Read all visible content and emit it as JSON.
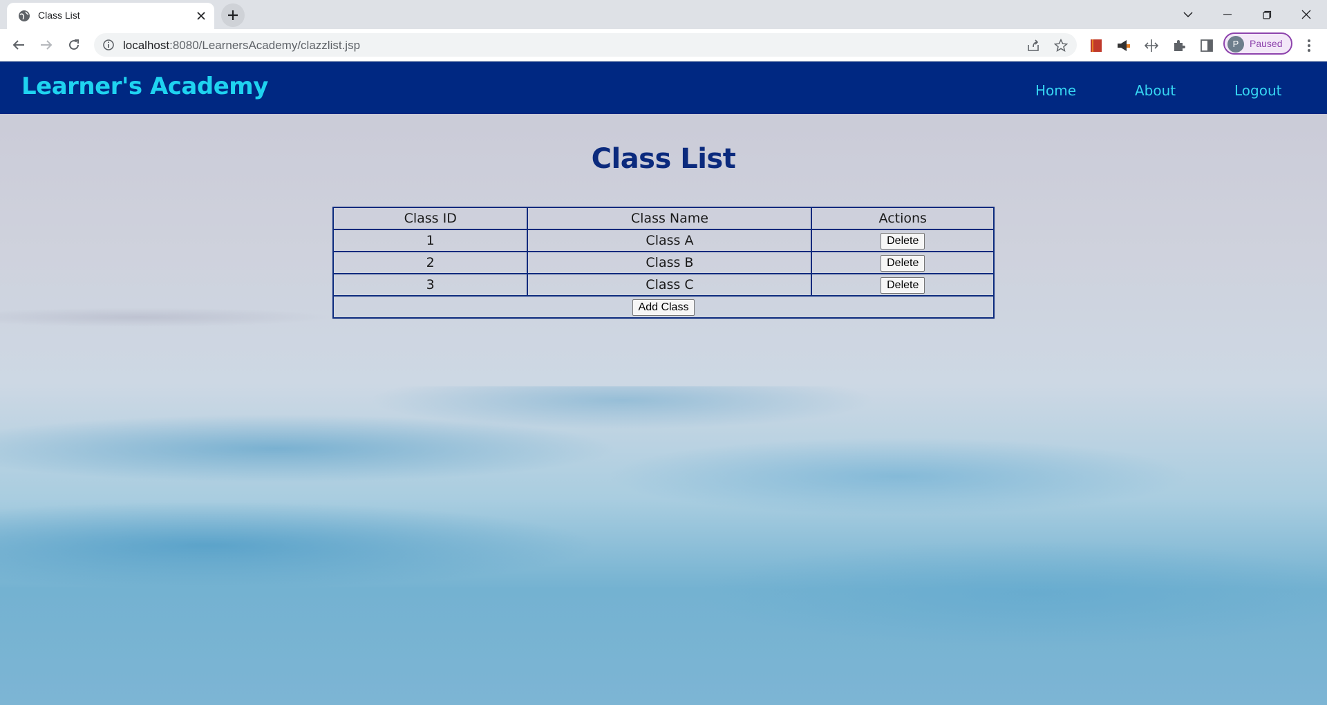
{
  "browser": {
    "tab_title": "Class List",
    "url_host": "localhost",
    "url_path": ":8080/LearnersAcademy/clazzlist.jsp",
    "profile_initial": "P",
    "profile_status": "Paused"
  },
  "header": {
    "brand": "Learner's Academy",
    "nav": [
      "Home",
      "About",
      "Logout"
    ]
  },
  "main": {
    "title": "Class List",
    "table": {
      "headers": [
        "Class ID",
        "Class Name",
        "Actions"
      ],
      "rows": [
        {
          "id": "1",
          "name": "Class A",
          "action": "Delete"
        },
        {
          "id": "2",
          "name": "Class B",
          "action": "Delete"
        },
        {
          "id": "3",
          "name": "Class C",
          "action": "Delete"
        }
      ],
      "add_label": "Add Class"
    }
  },
  "colors": {
    "header_bg": "#002882",
    "brand": "#1fd3f0",
    "title": "#0b2a7d"
  }
}
